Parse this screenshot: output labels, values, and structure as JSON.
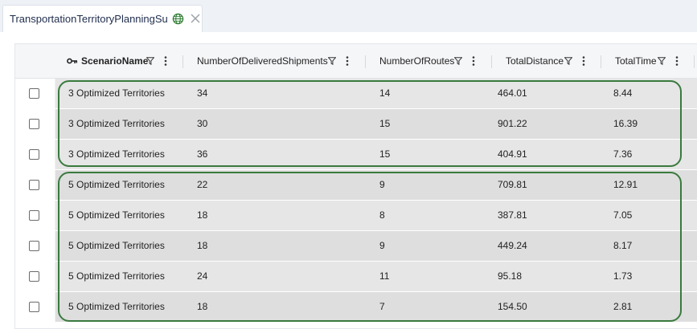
{
  "tab": {
    "title": "TransportationTerritoryPlanningSu"
  },
  "columns": [
    {
      "label": "ScenarioName",
      "key": true
    },
    {
      "label": "NumberOfDeliveredShipments",
      "key": false
    },
    {
      "label": "NumberOfRoutes",
      "key": false
    },
    {
      "label": "TotalDistance",
      "key": false
    },
    {
      "label": "TotalTime",
      "key": false
    }
  ],
  "rows": [
    [
      "3 Optimized Territories",
      "34",
      "14",
      "464.01",
      "8.44"
    ],
    [
      "3 Optimized Territories",
      "30",
      "15",
      "901.22",
      "16.39"
    ],
    [
      "3 Optimized Territories",
      "36",
      "15",
      "404.91",
      "7.36"
    ],
    [
      "5 Optimized Territories",
      "22",
      "9",
      "709.81",
      "12.91"
    ],
    [
      "5 Optimized Territories",
      "18",
      "8",
      "387.81",
      "7.05"
    ],
    [
      "5 Optimized Territories",
      "18",
      "9",
      "449.24",
      "8.17"
    ],
    [
      "5 Optimized Territories",
      "24",
      "11",
      "95.18",
      "1.73"
    ],
    [
      "5 Optimized Territories",
      "18",
      "7",
      "154.50",
      "2.81"
    ]
  ],
  "colors": {
    "highlight": "#3a7a3f",
    "row_band": "#e6e6e6",
    "header_bg": "#f5f6f8"
  },
  "icons": {
    "key": "key-icon",
    "filter": "filter-icon",
    "menu": "kebab-menu-icon",
    "globe": "globe-icon",
    "close": "close-icon"
  }
}
